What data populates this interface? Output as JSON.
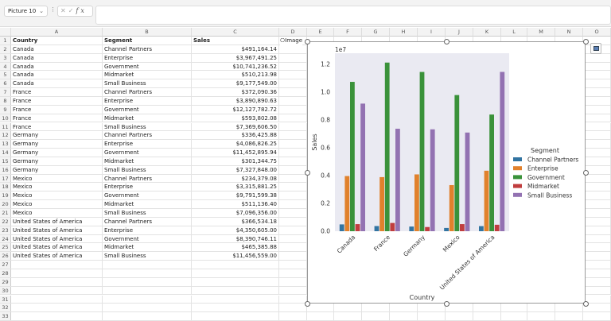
{
  "toolbar": {
    "name_box": "Picture 10",
    "fx_label": "fx",
    "formula_value": ""
  },
  "columns": [
    "A",
    "B",
    "C",
    "D",
    "E",
    "F",
    "G",
    "H",
    "I",
    "J",
    "K",
    "L",
    "M",
    "N",
    "O"
  ],
  "image_label": "Image",
  "sheet": {
    "headers": [
      "Country",
      "Segment",
      "Sales"
    ],
    "rows": [
      [
        "Canada",
        "Channel Partners",
        "$491,164.14"
      ],
      [
        "Canada",
        "Enterprise",
        "$3,967,491.25"
      ],
      [
        "Canada",
        "Government",
        "$10,741,236.52"
      ],
      [
        "Canada",
        "Midmarket",
        "$510,213.98"
      ],
      [
        "Canada",
        "Small Business",
        "$9,177,549.00"
      ],
      [
        "France",
        "Channel Partners",
        "$372,090.36"
      ],
      [
        "France",
        "Enterprise",
        "$3,890,890.63"
      ],
      [
        "France",
        "Government",
        "$12,127,782.72"
      ],
      [
        "France",
        "Midmarket",
        "$593,802.08"
      ],
      [
        "France",
        "Small Business",
        "$7,369,606.50"
      ],
      [
        "Germany",
        "Channel Partners",
        "$336,425.88"
      ],
      [
        "Germany",
        "Enterprise",
        "$4,086,826.25"
      ],
      [
        "Germany",
        "Government",
        "$11,452,895.94"
      ],
      [
        "Germany",
        "Midmarket",
        "$301,344.75"
      ],
      [
        "Germany",
        "Small Business",
        "$7,327,848.00"
      ],
      [
        "Mexico",
        "Channel Partners",
        "$234,379.08"
      ],
      [
        "Mexico",
        "Enterprise",
        "$3,315,881.25"
      ],
      [
        "Mexico",
        "Government",
        "$9,791,599.38"
      ],
      [
        "Mexico",
        "Midmarket",
        "$511,136.40"
      ],
      [
        "Mexico",
        "Small Business",
        "$7,096,356.00"
      ],
      [
        "United States of America",
        "Channel Partners",
        "$366,534.18"
      ],
      [
        "United States of America",
        "Enterprise",
        "$4,350,605.00"
      ],
      [
        "United States of America",
        "Government",
        "$8,390,746.11"
      ],
      [
        "United States of America",
        "Midmarket",
        "$465,385.88"
      ],
      [
        "United States of America",
        "Small Business",
        "$11,456,559.00"
      ]
    ]
  },
  "chart_data": {
    "type": "bar",
    "xlabel": "Country",
    "ylabel": "Sales",
    "offset_label": "1e7",
    "categories": [
      "Canada",
      "France",
      "Germany",
      "Mexico",
      "United States of America"
    ],
    "yticks": [
      "0.0",
      "0.2",
      "0.4",
      "0.6",
      "0.8",
      "1.0",
      "1.2"
    ],
    "ylim": [
      0,
      1.28
    ],
    "legend_title": "Segment",
    "legend_position": "right",
    "series": [
      {
        "name": "Channel Partners",
        "color": "#3274a1",
        "values": [
          0.0491,
          0.0372,
          0.0336,
          0.0234,
          0.0367
        ]
      },
      {
        "name": "Enterprise",
        "color": "#e1812c",
        "values": [
          0.3967,
          0.3891,
          0.4087,
          0.3316,
          0.4351
        ]
      },
      {
        "name": "Government",
        "color": "#3a923a",
        "values": [
          1.0741,
          1.2128,
          1.1453,
          0.9792,
          0.8391
        ]
      },
      {
        "name": "Midmarket",
        "color": "#c03d3e",
        "values": [
          0.051,
          0.0594,
          0.0301,
          0.0511,
          0.0465
        ]
      },
      {
        "name": "Small Business",
        "color": "#9372b2",
        "values": [
          0.9178,
          0.737,
          0.7328,
          0.7096,
          1.1457
        ]
      }
    ],
    "plot_bg": "#eaeaf2"
  }
}
